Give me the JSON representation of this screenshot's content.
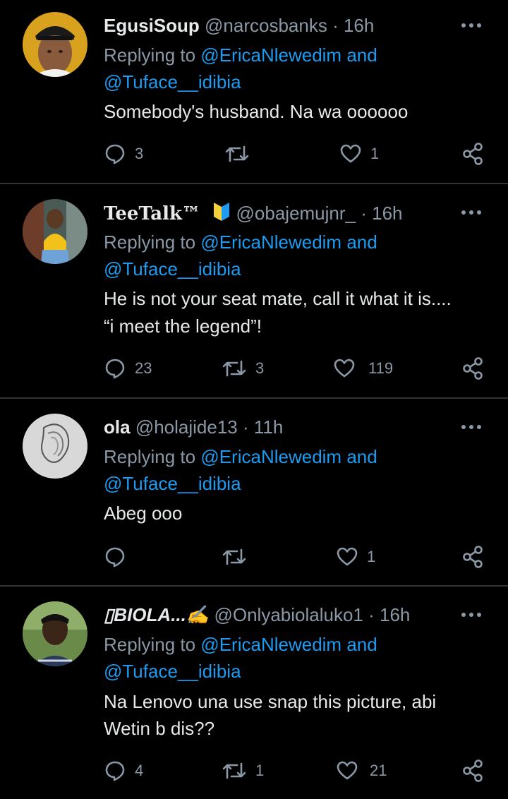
{
  "tweets": [
    {
      "name": "EgusiSoup",
      "handle": "@narcosbanks",
      "separator": "·",
      "time": "16h",
      "replying_to_prefix": "Replying to",
      "reply_user1": "@EricaNlewedim",
      "reply_and": "and",
      "reply_user2": "@Tuface__idibia",
      "text_lines": [
        "Somebody's husband. Na wa oooooo"
      ],
      "replies": "3",
      "retweets": "",
      "likes": "1"
    },
    {
      "name": "TeeTalk™",
      "handle": "@obajemujnr_",
      "separator": "·",
      "time": "16h",
      "replying_to_prefix": "Replying to",
      "reply_user1": "@EricaNlewedim",
      "reply_and": "and",
      "reply_user2": "@Tuface__idibia",
      "text_lines": [
        "He is not your seat mate, call it what it is....",
        "“i meet the legend”!"
      ],
      "replies": "23",
      "retweets": "3",
      "likes": "119"
    },
    {
      "name": "ola",
      "handle": "@holajide13",
      "separator": "·",
      "time": "11h",
      "replying_to_prefix": "Replying to",
      "reply_user1": "@EricaNlewedim",
      "reply_and": "and",
      "reply_user2": "@Tuface__idibia",
      "text_lines": [
        "Abeg ooo"
      ],
      "replies": "",
      "retweets": "",
      "likes": "1"
    },
    {
      "name": "▯BIOLA...✍",
      "handle": "@Onlyabiolaluko1",
      "separator": "·",
      "time": "16h",
      "replying_to_prefix": "Replying to",
      "reply_user1": "@EricaNlewedim",
      "reply_and": "and",
      "reply_user2": "@Tuface__idibia",
      "text_lines": [
        "Na Lenovo una use snap this picture, abi",
        "Wetin b dis??"
      ],
      "replies": "4",
      "retweets": "1",
      "likes": "21"
    }
  ],
  "colors": {
    "background": "#000000",
    "text": "#e7e9ea",
    "muted": "#8b98a5",
    "link": "#1d9bf0",
    "divider": "#2f3336",
    "badge_yellow": "#f4d03f",
    "badge_blue": "#1d9bf0"
  }
}
